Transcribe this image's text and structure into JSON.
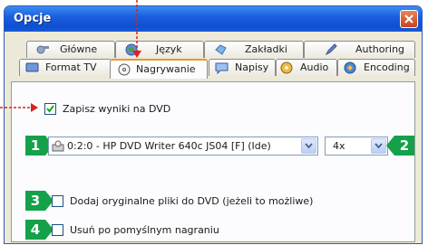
{
  "window": {
    "title": "Opcje"
  },
  "tabs_row1": [
    {
      "label": "Główne",
      "icon": "wrench-gear-icon"
    },
    {
      "label": "Język",
      "icon": "globe-icon"
    },
    {
      "label": "Zakładki",
      "icon": "bookmark-icon"
    },
    {
      "label": "Authoring",
      "icon": "pencil-icon"
    }
  ],
  "tabs_row2": [
    {
      "label": "Format TV",
      "icon": "tv-icon"
    },
    {
      "label": "Nagrywanie",
      "icon": "disc-icon",
      "active": true
    },
    {
      "label": "Napisy",
      "icon": "subtitles-icon"
    },
    {
      "label": "Audio",
      "icon": "audio-icon"
    },
    {
      "label": "Encoding",
      "icon": "encoding-icon"
    }
  ],
  "recording": {
    "save_to_dvd": {
      "label": "Zapisz wyniki na DVD",
      "checked": true
    },
    "drive": {
      "value": "0:2:0 - HP DVD Writer 640c JS04 [F] (Ide)"
    },
    "speed": {
      "value": "4x"
    },
    "add_original": {
      "label": "Dodaj oryginalne pliki do DVD (jeżeli to możliwe)",
      "checked": false
    },
    "delete_after": {
      "label": "Usuń po pomyślnym nagraniu",
      "checked": false
    }
  },
  "annotations": {
    "badge1": "1",
    "badge2": "2",
    "badge3": "3",
    "badge4": "4"
  },
  "colors": {
    "annotation_red": "#e0201b",
    "badge_green": "#14a14a",
    "titlebar_blue": "#1b5fe0"
  }
}
